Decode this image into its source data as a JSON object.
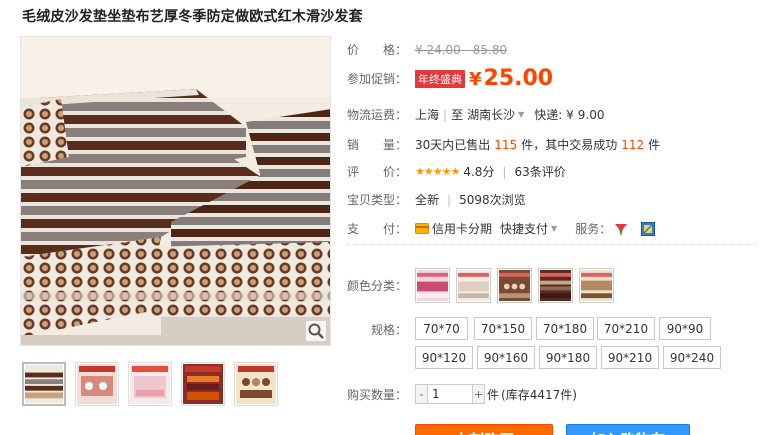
{
  "product": {
    "title": "毛绒皮沙发垫坐垫布艺厚冬季防定做欧式红木滑沙发套"
  },
  "price": {
    "label": "价　　格：",
    "original": "¥ 24.00 - 85.80"
  },
  "promo": {
    "label": "参加促销：",
    "badge": "年终盛典",
    "yen": "¥",
    "price": "25.00"
  },
  "shipping": {
    "label": "物流运费：",
    "from": "上海",
    "sep": "|",
    "to_prefix": "至",
    "to": "湖南长沙",
    "express_label": "快递:",
    "express_price": "¥ 9.00"
  },
  "sales": {
    "label": "销　　量：",
    "prefix": "30天内已售出",
    "sold": "115",
    "middle": "件，其中交易成功",
    "success": "112",
    "suffix": "件"
  },
  "rating": {
    "label": "评　　价：",
    "stars": "★★★★★",
    "score": "4.8分",
    "sep": "|",
    "reviews": "63条评价"
  },
  "item_type": {
    "label": "宝贝类型：",
    "condition": "全新",
    "sep": "|",
    "views": "5098次浏览"
  },
  "payment": {
    "label": "支　　付：",
    "credit": "信用卡分期",
    "quick": "快捷支付",
    "service_label": "服务："
  },
  "color": {
    "label": "颜色分类：",
    "count": 5
  },
  "size": {
    "label": "规格：",
    "options": [
      "70*70",
      "70*150",
      "70*180",
      "70*210",
      "90*90",
      "90*120",
      "90*160",
      "90*180",
      "90*210",
      "90*240"
    ]
  },
  "quantity": {
    "label": "购买数量：",
    "minus": "-",
    "value": "1",
    "plus": "+",
    "unit": "件",
    "stock": "(库存4417件)"
  },
  "actions": {
    "buy": "立刻购买",
    "cart": "加入购物车"
  },
  "colors": {
    "accent": "#ff4400",
    "promo_badge": "#e4393c",
    "star": "#ff9900",
    "cart": "#3399ff"
  }
}
